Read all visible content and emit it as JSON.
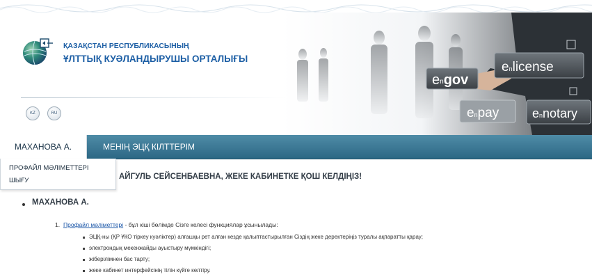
{
  "header": {
    "org_line1": "ҚАЗАҚСТАН РЕСПУБЛИКАСЫНЫҢ",
    "org_line2": "ҰЛТТЫҚ КУӘЛАНДЫРУШЫ ОРТАЛЫҒЫ",
    "logo_icon": "globe-logo-icon",
    "languages": [
      "KZ",
      "RU"
    ],
    "banner": {
      "labels": [
        "e-gov",
        "e-license",
        "e-pay",
        "e-notary"
      ],
      "label_parts": [
        {
          "prefix": "e",
          "sub": "n",
          "word": "gov"
        },
        {
          "prefix": "e",
          "sub": "n",
          "word": "license"
        },
        {
          "prefix": "e",
          "sub": "n",
          "word": "pay"
        },
        {
          "prefix": "e",
          "sub": "n",
          "word": "notary"
        }
      ]
    }
  },
  "nav": {
    "tabs": [
      {
        "label": "МАХАНОВА А."
      },
      {
        "label": "МЕНІҢ ЭЦҚ КІЛТТЕРІМ"
      }
    ],
    "dropdown": [
      {
        "label": "ПРОФАЙЛ МӘЛІМЕТТЕРІ"
      },
      {
        "label": "ШЫҒУ"
      }
    ]
  },
  "main": {
    "welcome": "АЙГУЛЬ СЕЙСЕНБАЕВНА, ЖЕКЕ КАБИНЕТКЕ ҚОШ КЕЛДІҢІЗ!",
    "section_title": "МАХАНОВА А.",
    "item1": {
      "number": "1.",
      "link": "Профайл мәліметтері",
      "text": " - бұл кіші бөлімде Сізге келесі функциялар ұсынылады:"
    },
    "subitems": [
      "ЭЦҚ-ны (ҚР ҰКО тіркеу куәліктер) алғашқы рет алған кезде қалыптастырылған Сіздің жеке деректеріңіз туралы ақпаратты қарау;",
      "электрондық мекенжайды ауыстыру мүмкіндігі;",
      "жіберілімнен бас тарту;",
      "жеке кабинет интерфейсінің тілін күйге келтіру."
    ]
  },
  "colors": {
    "nav_bar": "#2c6784",
    "brand_blue": "#1d5fa5",
    "link": "#1a56a8"
  }
}
